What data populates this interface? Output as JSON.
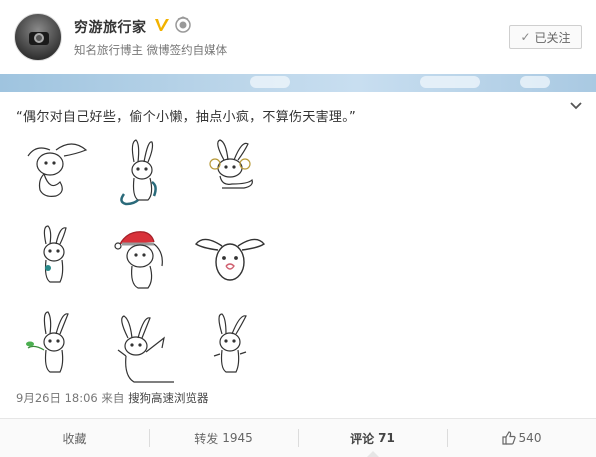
{
  "user": {
    "name": "穷游旅行家",
    "description": "知名旅行博主 微博签约自媒体",
    "follow_label": "已关注",
    "follow_icon": "✓"
  },
  "post": {
    "text": "“偶尔对自己好些，偷个小懒，抽点小疯，不算伤天害理。”",
    "date": "9月26日 18:06",
    "from_label": "来自",
    "source": "搜狗高速浏览器",
    "images": [
      "rabbit-sketch-1",
      "rabbit-sketch-2",
      "rabbit-sketch-3",
      "rabbit-sketch-4",
      "rabbit-sketch-5",
      "rabbit-sketch-6",
      "rabbit-sketch-7",
      "rabbit-sketch-8",
      "rabbit-sketch-9"
    ]
  },
  "actions": {
    "favorite": "收藏",
    "repost": "转发",
    "repost_count": "1945",
    "comment": "评论",
    "comment_count": "71",
    "like_count": "540"
  },
  "colors": {
    "vip_gold": "#f2b200",
    "banner_blue": "#a9c9e2",
    "text_main": "#333333",
    "text_muted": "#777777"
  }
}
